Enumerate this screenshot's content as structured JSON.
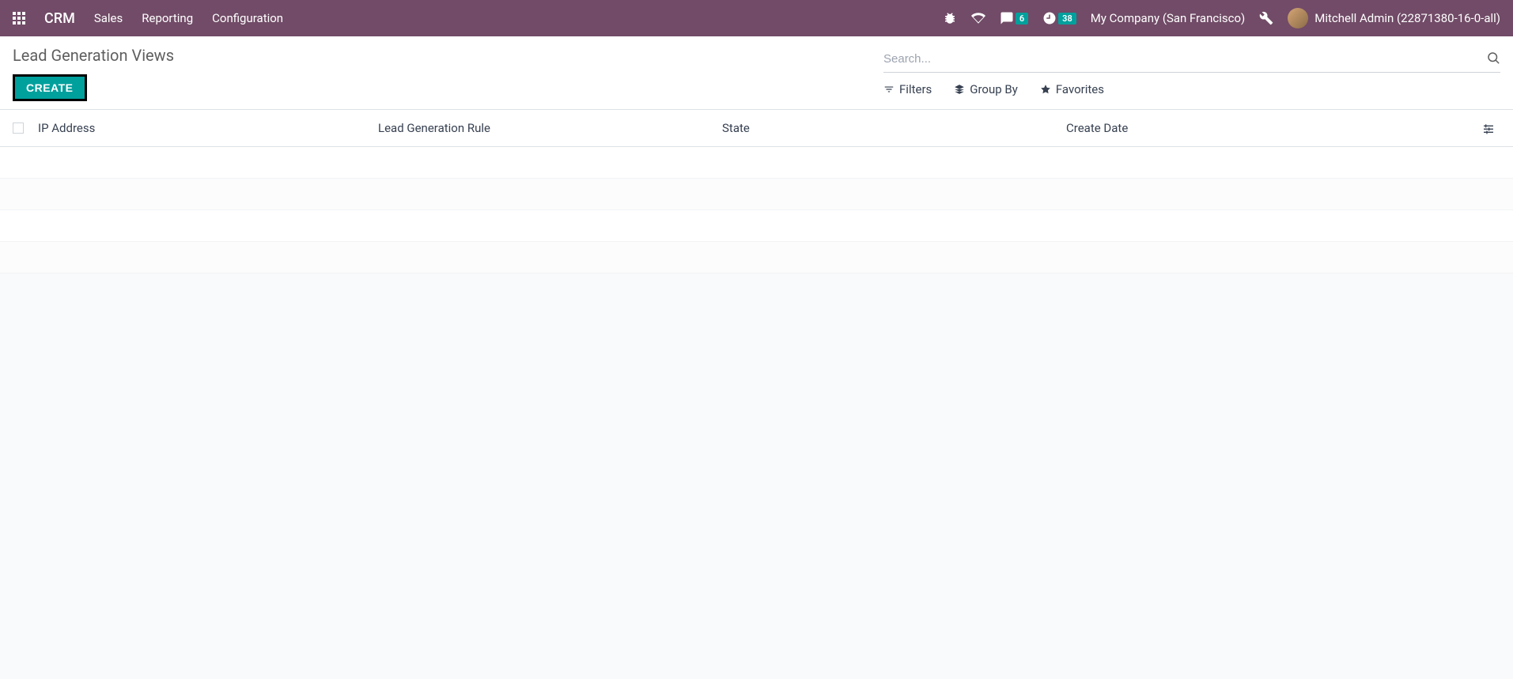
{
  "navbar": {
    "brand": "CRM",
    "links": [
      "Sales",
      "Reporting",
      "Configuration"
    ],
    "messaging_badge": "6",
    "activities_badge": "38",
    "company": "My Company (San Francisco)",
    "user": "Mitchell Admin (22871380-16-0-all)"
  },
  "control_panel": {
    "breadcrumb": "Lead Generation Views",
    "create_label": "CREATE",
    "search_placeholder": "Search...",
    "filters_label": "Filters",
    "groupby_label": "Group By",
    "favorites_label": "Favorites"
  },
  "table": {
    "columns": {
      "ip": "IP Address",
      "rule": "Lead Generation Rule",
      "state": "State",
      "date": "Create Date"
    },
    "rows": []
  }
}
